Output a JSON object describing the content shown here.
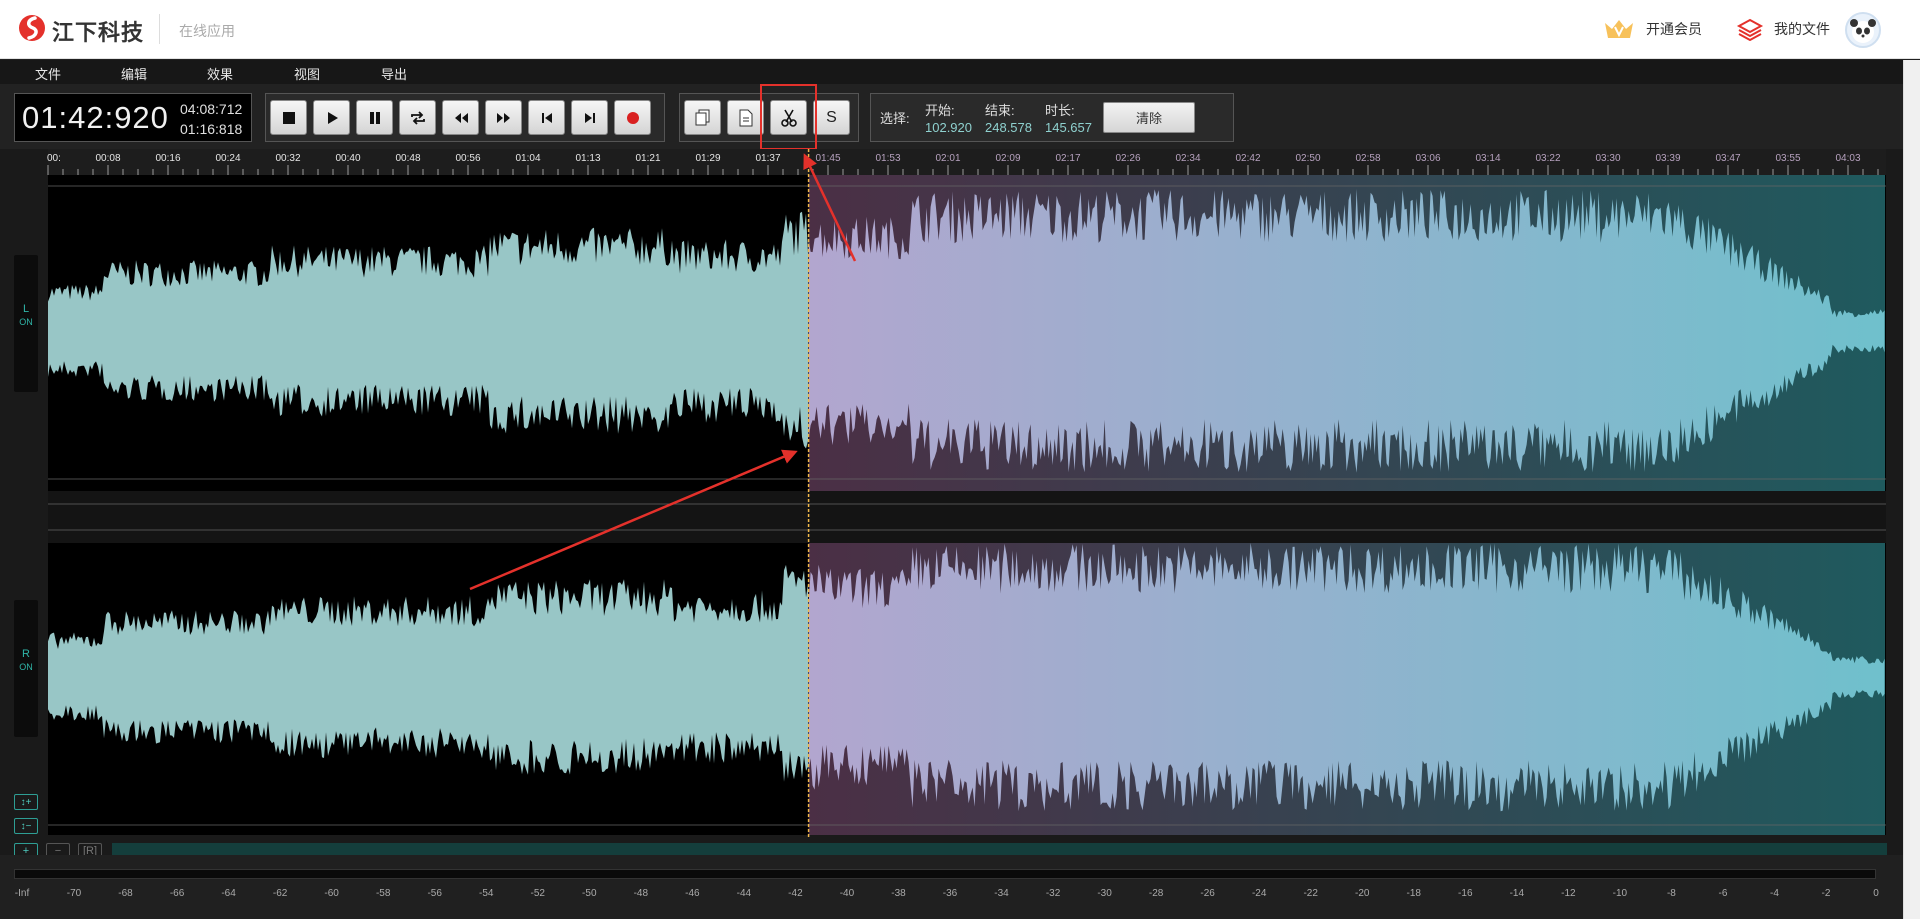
{
  "header": {
    "brand": "江下科技",
    "subtitle": "在线应用",
    "vip_label": "开通会员",
    "files_label": "我的文件"
  },
  "menu": [
    "文件",
    "编辑",
    "效果",
    "视图",
    "导出"
  ],
  "time": {
    "current": "01:42:920",
    "total": "04:08:712",
    "position": "01:16:818"
  },
  "transport": [
    "stop-icon",
    "play-icon",
    "pause-icon",
    "loop-icon",
    "rewind-icon",
    "fast-forward-icon",
    "skip-start-icon",
    "skip-end-icon",
    "record-icon"
  ],
  "edit_tools": [
    "copy-icon",
    "paste-icon",
    "cut-icon",
    "s-icon"
  ],
  "edit_s_label": "S",
  "selection": {
    "label": "选择:",
    "start_key": "开始:",
    "start_value": "102.920",
    "end_key": "结束:",
    "end_value": "248.578",
    "duration_key": "时长:",
    "duration_value": "145.657",
    "clear_label": "清除"
  },
  "timeline": {
    "ticks": [
      "00:",
      "00:08",
      "00:16",
      "00:24",
      "00:32",
      "00:40",
      "00:48",
      "00:56",
      "01:04",
      "01:13",
      "01:21",
      "01:29",
      "01:37",
      "01:45",
      "01:53",
      "02:01",
      "02:09",
      "02:17",
      "02:26",
      "02:34",
      "02:42",
      "02:50",
      "02:58",
      "03:06",
      "03:14",
      "03:22",
      "03:30",
      "03:39",
      "03:47",
      "03:55",
      "04:03"
    ],
    "total_seconds": 248.712,
    "playhead_seconds": 102.92,
    "selection_start_seconds": 102.92,
    "selection_end_seconds": 248.578
  },
  "channels": [
    {
      "letter": "L",
      "status": "ON"
    },
    {
      "letter": "R",
      "status": "ON"
    }
  ],
  "zoom": {
    "in_label": "↕+",
    "out_label": "↕−",
    "h_plus": "+",
    "h_minus": "−",
    "reset": "[R]"
  },
  "meter": {
    "labels": [
      "-Inf",
      "-70",
      "-68",
      "-66",
      "-64",
      "-62",
      "-60",
      "-58",
      "-56",
      "-54",
      "-52",
      "-50",
      "-48",
      "-46",
      "-44",
      "-42",
      "-40",
      "-38",
      "-36",
      "-34",
      "-32",
      "-30",
      "-28",
      "-26",
      "-24",
      "-22",
      "-20",
      "-18",
      "-16",
      "-14",
      "-12",
      "-10",
      "-8",
      "-6",
      "-4",
      "-2",
      "0"
    ]
  },
  "colors": {
    "waveform": "#98c6c6",
    "selection_start": "#4b2f45",
    "selection_end": "#1f5a5e",
    "playhead": "#f0b84a",
    "annotation": "#e4312b"
  }
}
